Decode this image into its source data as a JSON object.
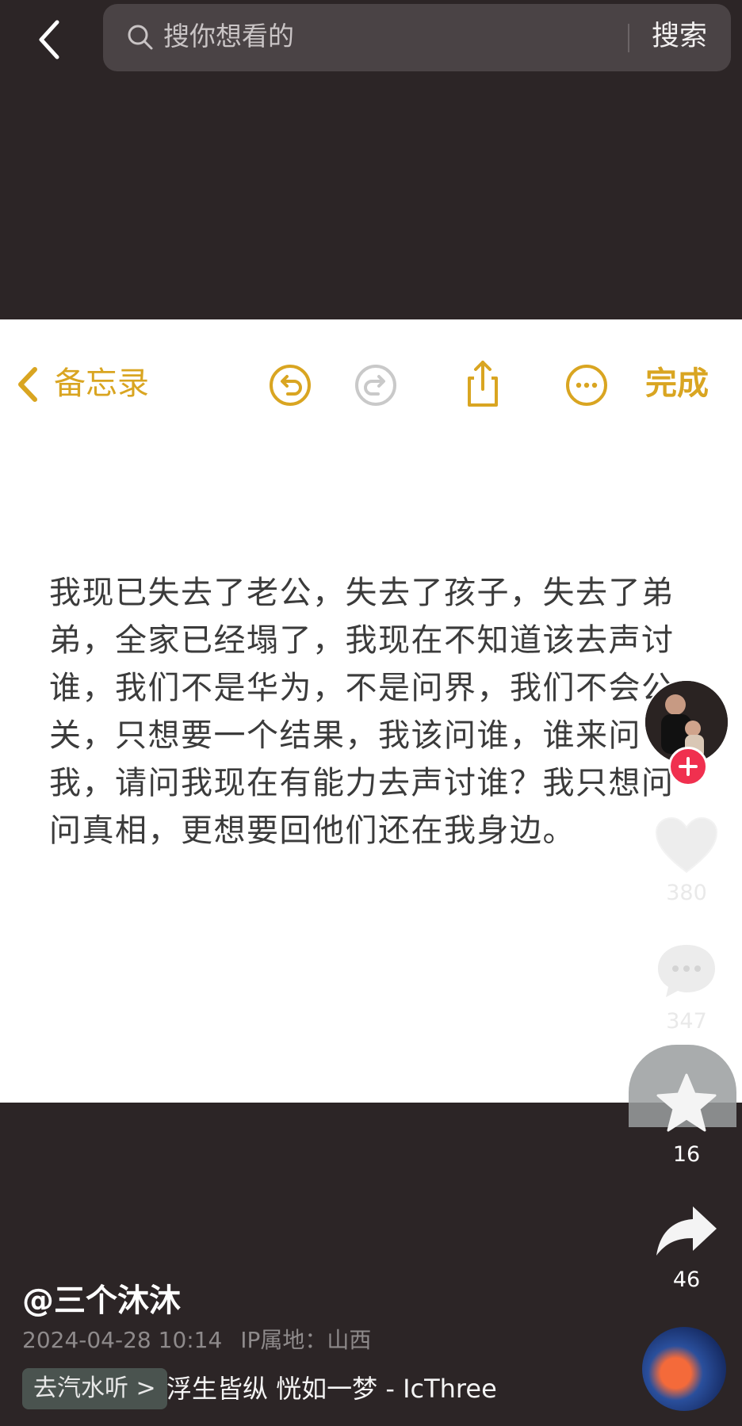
{
  "search": {
    "placeholder": "搜你想看的",
    "button_label": "搜索"
  },
  "notes": {
    "back_label": "备忘录",
    "done_label": "完成",
    "tools": [
      "undo-icon",
      "redo-icon",
      "share-icon",
      "more-icon"
    ],
    "body": "我现已失去了老公，失去了孩子，失去了弟弟，全家已经塌了，我现在不知道该去声讨谁，我们不是华为，不是问界，我们不会公关，只想要一个结果，我该问谁，谁来问我，请问我现在有能力去声讨谁？我只想问问真相，更想要回他们还在我身边。"
  },
  "rail": {
    "likes": "380",
    "comments": "347",
    "favorites": "16",
    "shares": "46"
  },
  "post": {
    "author": "@三个沐沐",
    "date": "2024-04-28 10:14",
    "ip_label": "IP属地：山西",
    "music_tag": "去汽水听 >",
    "music_title": "浮生皆纵 恍如一梦 - IcThree"
  },
  "colors": {
    "background": "#2c2526",
    "notes_accent": "#d9a521",
    "follow_red": "#f0304f"
  }
}
